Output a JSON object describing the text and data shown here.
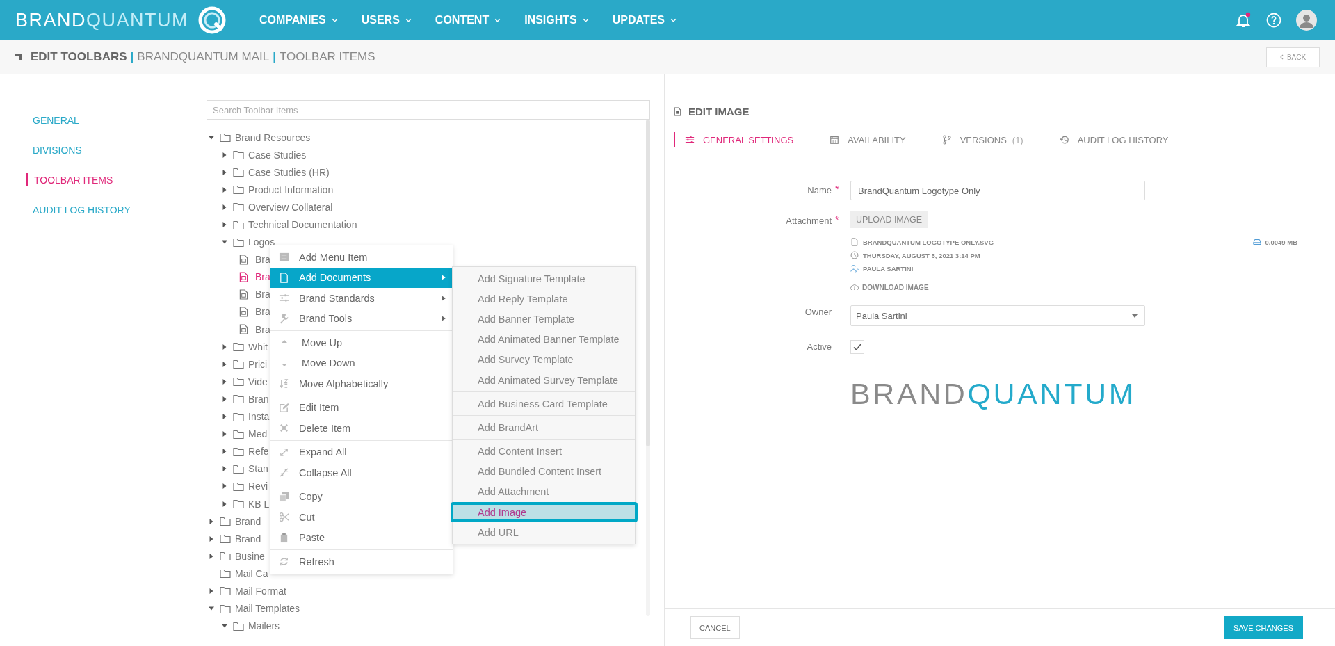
{
  "header": {
    "logo": {
      "brand": "BRAND",
      "quantum": "QUANTUM"
    },
    "nav": [
      {
        "label": "COMPANIES"
      },
      {
        "label": "USERS"
      },
      {
        "label": "CONTENT"
      },
      {
        "label": "INSIGHTS"
      },
      {
        "label": "UPDATES"
      }
    ],
    "notifications": {
      "unread": true
    }
  },
  "breadcrumb": [
    {
      "label": "EDIT TOOLBARS",
      "kind": "title"
    },
    {
      "label": "|",
      "kind": "separator"
    },
    {
      "label": "BRANDQUANTUM MAIL",
      "kind": "crumb"
    },
    {
      "label": "|",
      "kind": "separator"
    },
    {
      "label": "TOOLBAR ITEMS",
      "kind": "crumb"
    }
  ],
  "back_button": "BACK",
  "side_nav": [
    {
      "label": "GENERAL",
      "selected": false
    },
    {
      "label": "DIVISIONS",
      "selected": false
    },
    {
      "label": "TOOLBAR ITEMS",
      "selected": true
    },
    {
      "label": "AUDIT LOG HISTORY",
      "selected": false
    }
  ],
  "search": {
    "placeholder": "Search Toolbar Items"
  },
  "tree": [
    {
      "label": "Brand Resources",
      "kind": "folder",
      "expanded": true,
      "children": [
        {
          "label": "Case Studies",
          "kind": "folder",
          "expanded": false
        },
        {
          "label": "Case Studies (HR)",
          "kind": "folder",
          "expanded": false
        },
        {
          "label": "Product Information",
          "kind": "folder",
          "expanded": false
        },
        {
          "label": "Overview Collateral",
          "kind": "folder",
          "expanded": false
        },
        {
          "label": "Technical Documentation",
          "kind": "folder",
          "expanded": false
        },
        {
          "label": "Logos",
          "kind": "folder",
          "expanded": true,
          "children": [
            {
              "label": "Bra",
              "kind": "file",
              "selected": false
            },
            {
              "label": "Bra",
              "kind": "file",
              "selected": true
            },
            {
              "label": "Bra",
              "kind": "file",
              "selected": false
            },
            {
              "label": "Bra",
              "kind": "file",
              "selected": false
            },
            {
              "label": "Bra",
              "kind": "file",
              "selected": false
            }
          ]
        },
        {
          "label": "Whit",
          "kind": "folder",
          "expanded": false
        },
        {
          "label": "Prici",
          "kind": "folder",
          "expanded": false
        },
        {
          "label": "Vide",
          "kind": "folder",
          "expanded": false
        },
        {
          "label": "Bran",
          "kind": "folder",
          "expanded": false
        },
        {
          "label": "Insta",
          "kind": "folder",
          "expanded": false
        },
        {
          "label": "Med",
          "kind": "folder",
          "expanded": false
        },
        {
          "label": "Refe",
          "kind": "folder",
          "expanded": false
        },
        {
          "label": "Stan",
          "kind": "folder",
          "expanded": false
        },
        {
          "label": "Revi",
          "kind": "folder",
          "expanded": false
        },
        {
          "label": "KB L",
          "kind": "folder",
          "expanded": false
        }
      ]
    },
    {
      "label": "Brand",
      "kind": "folder",
      "expanded": false
    },
    {
      "label": "Brand",
      "kind": "folder",
      "expanded": false
    },
    {
      "label": "Busine",
      "kind": "folder",
      "expanded": false
    },
    {
      "label": "Mail Ca",
      "kind": "empty-folder"
    },
    {
      "label": "Mail Format",
      "kind": "folder",
      "expanded": false
    },
    {
      "label": "Mail Templates",
      "kind": "folder",
      "expanded": true,
      "children": [
        {
          "label": "Mailers",
          "kind": "folder",
          "expanded": true
        }
      ]
    }
  ],
  "context_menu": {
    "groups": [
      {
        "items": [
          {
            "label": "Add Menu Item",
            "has_submenu": false,
            "selected": false
          },
          {
            "label": "Add Documents",
            "has_submenu": true,
            "selected": true
          },
          {
            "label": "Brand Standards",
            "has_submenu": true,
            "selected": false
          },
          {
            "label": "Brand Tools",
            "has_submenu": true,
            "selected": false
          }
        ]
      },
      {
        "items": [
          {
            "label": "Move Up",
            "has_submenu": false,
            "selected": false
          },
          {
            "label": "Move Down",
            "has_submenu": false,
            "selected": false
          },
          {
            "label": "Move Alphabetically",
            "has_submenu": false,
            "selected": false
          }
        ]
      },
      {
        "items": [
          {
            "label": "Edit Item",
            "has_submenu": false,
            "selected": false
          },
          {
            "label": "Delete Item",
            "has_submenu": false,
            "selected": false
          }
        ]
      },
      {
        "items": [
          {
            "label": "Expand All",
            "has_submenu": false,
            "selected": false
          },
          {
            "label": "Collapse All",
            "has_submenu": false,
            "selected": false
          }
        ]
      },
      {
        "items": [
          {
            "label": "Copy",
            "has_submenu": false,
            "selected": false
          },
          {
            "label": "Cut",
            "has_submenu": false,
            "selected": false
          },
          {
            "label": "Paste",
            "has_submenu": false,
            "selected": false
          }
        ]
      },
      {
        "items": [
          {
            "label": "Refresh",
            "has_submenu": false,
            "selected": false
          }
        ]
      }
    ]
  },
  "submenu": {
    "groups": [
      {
        "items": [
          {
            "label": "Add Signature Template",
            "selected": false
          },
          {
            "label": "Add Reply Template",
            "selected": false
          },
          {
            "label": "Add Banner Template",
            "selected": false
          },
          {
            "label": "Add Animated Banner Template",
            "selected": false
          },
          {
            "label": "Add Survey Template",
            "selected": false
          },
          {
            "label": "Add Animated Survey Template",
            "selected": false
          }
        ]
      },
      {
        "items": [
          {
            "label": "Add Business Card Template",
            "selected": false
          }
        ]
      },
      {
        "items": [
          {
            "label": "Add BrandArt",
            "selected": false
          }
        ]
      },
      {
        "items": [
          {
            "label": "Add Content Insert",
            "selected": false
          },
          {
            "label": "Add Bundled Content Insert",
            "selected": false
          },
          {
            "label": "Add Attachment",
            "selected": false
          },
          {
            "label": "Add Image",
            "selected": true
          },
          {
            "label": "Add URL",
            "selected": false
          }
        ]
      }
    ]
  },
  "editor": {
    "title": "EDIT IMAGE",
    "tabs": [
      {
        "label": "GENERAL SETTINGS",
        "selected": true
      },
      {
        "label": "AVAILABILITY",
        "selected": false
      },
      {
        "label": "VERSIONS",
        "count": "(1)",
        "selected": false
      },
      {
        "label": "AUDIT LOG HISTORY",
        "selected": false
      }
    ],
    "form": {
      "name": {
        "label": "Name",
        "required_mark": "*",
        "value": "BrandQuantum Logotype Only"
      },
      "attachment": {
        "label": "Attachment",
        "required_mark": "*",
        "button": "UPLOAD IMAGE",
        "file_name": "BRANDQUANTUM LOGOTYPE ONLY.SVG",
        "date": "THURSDAY, AUGUST 5, 2021 3:14 PM",
        "author": "PAULA SARTINI",
        "size": "0.0049 MB",
        "download": "DOWNLOAD IMAGE"
      },
      "owner": {
        "label": "Owner",
        "value": "Paula Sartini"
      },
      "active": {
        "label": "Active",
        "checked": true
      }
    },
    "preview": {
      "brand": "BRAND",
      "quantum": "QUANTUM"
    }
  },
  "footer": {
    "cancel": "CANCEL",
    "save": "SAVE CHANGES"
  }
}
